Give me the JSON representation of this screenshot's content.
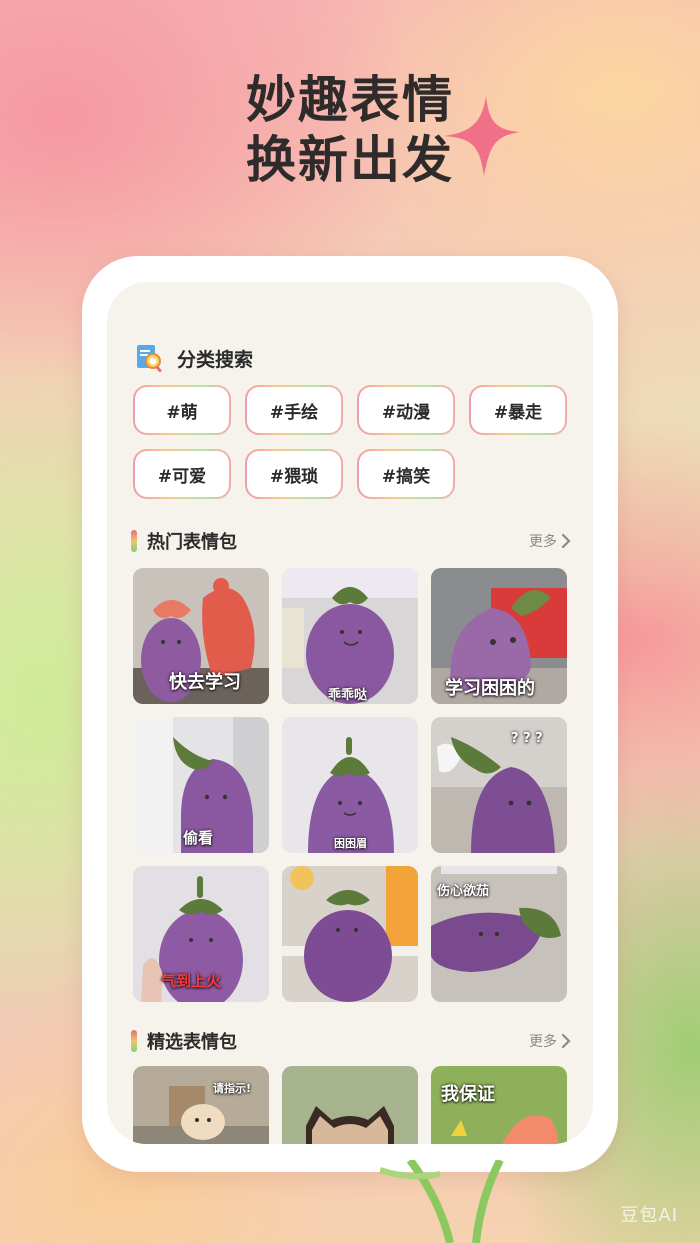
{
  "headline": {
    "line1": "妙趣表情",
    "line2": "换新出发"
  },
  "watermark": "豆包AI",
  "category": {
    "title": "分类搜索",
    "icon": "magnifier-document-icon",
    "tags": [
      "#萌",
      "#手绘",
      "#动漫",
      "#暴走",
      "#可爱",
      "#猥琐",
      "#搞笑"
    ]
  },
  "hot": {
    "title": "热门表情包",
    "more": "更多",
    "items": [
      {
        "caption": "快去学习"
      },
      {
        "caption": "乖乖哒"
      },
      {
        "caption": "学习困困的"
      },
      {
        "caption": "偷看"
      },
      {
        "caption": "困困眉"
      },
      {
        "caption": "? ? ?"
      },
      {
        "caption": "气到上火"
      },
      {
        "caption": ""
      },
      {
        "caption": "伤心欲茄"
      }
    ]
  },
  "featured": {
    "title": "精选表情包",
    "more": "更多",
    "items": [
      {
        "caption": "请指示!"
      },
      {
        "caption": ""
      },
      {
        "caption": "我保证"
      }
    ]
  },
  "colors": {
    "accent_pink": "#f0708a",
    "eggplant": "#8a5aa0",
    "leaf": "#5c7a3a",
    "screen_bg": "#f5f3ec"
  }
}
